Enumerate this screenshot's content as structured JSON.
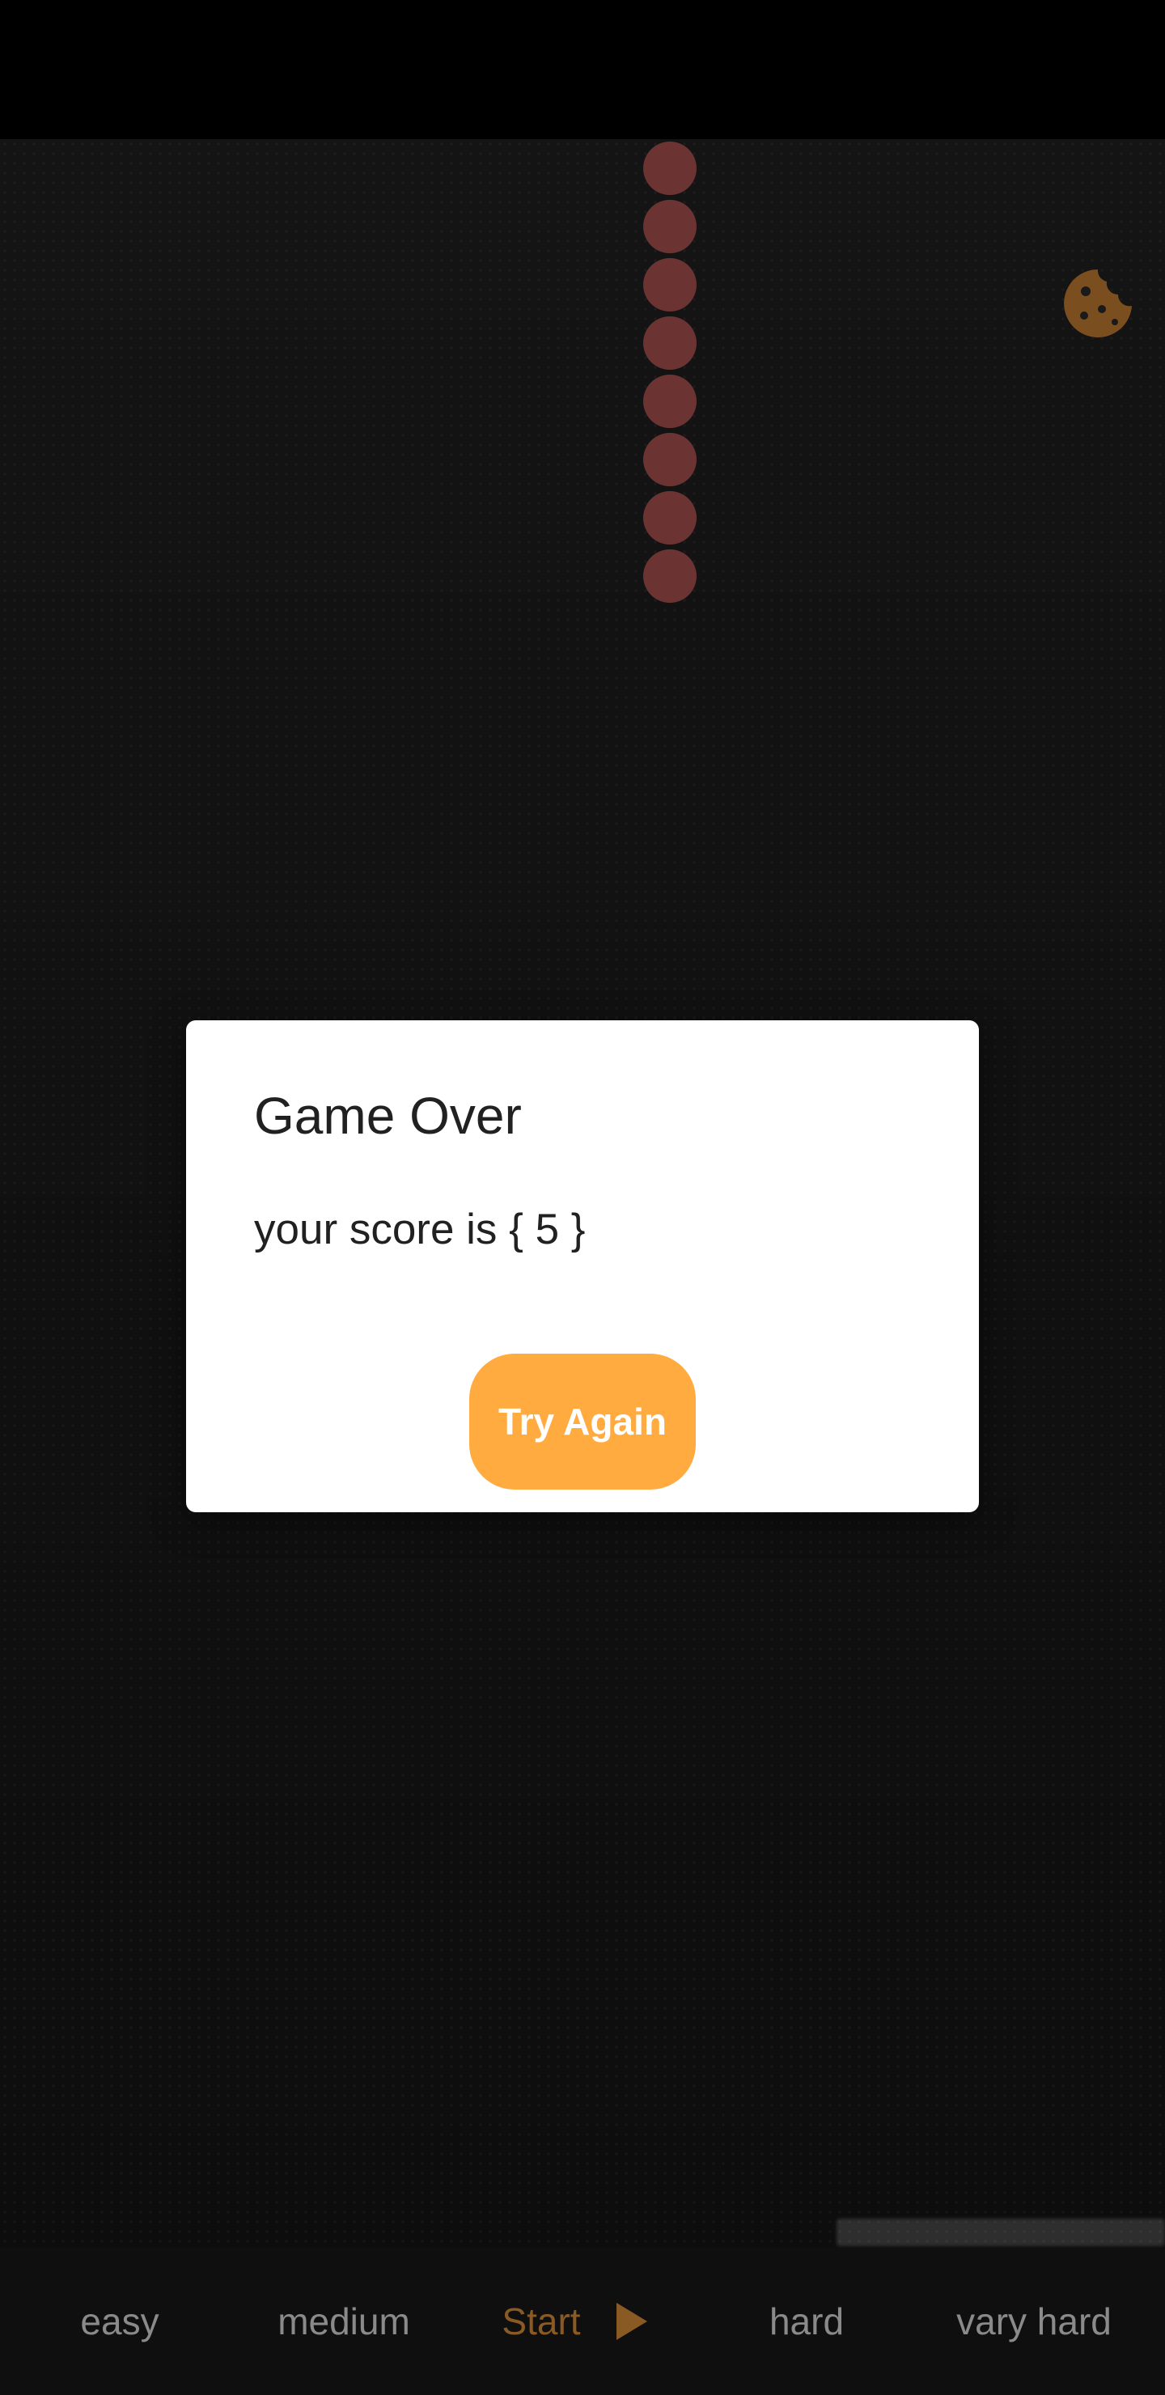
{
  "dialog": {
    "title": "Game Over",
    "message": "your score is { 5 }",
    "button_label": "Try Again"
  },
  "bottom_nav": {
    "easy": "easy",
    "medium": "medium",
    "start": "Start",
    "hard": "hard",
    "very_hard": "vary hard"
  },
  "icons": {
    "food": "cookie-icon",
    "start": "play-icon"
  },
  "colors": {
    "snake": "#6b3433",
    "food": "#7a4e1e",
    "button": "#ffab40",
    "start_accent": "#8a5a24"
  }
}
